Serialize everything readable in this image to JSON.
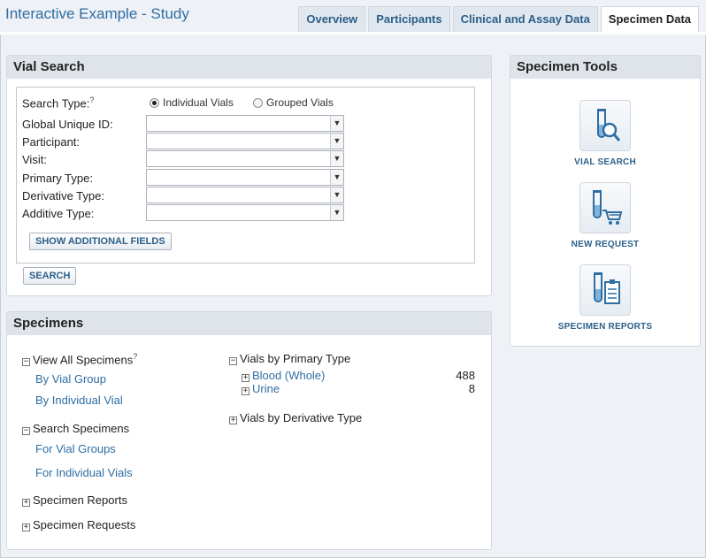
{
  "header": {
    "title": "Interactive Example - Study",
    "tabs": [
      {
        "label": "Overview",
        "active": false
      },
      {
        "label": "Participants",
        "active": false
      },
      {
        "label": "Clinical and Assay Data",
        "active": false
      },
      {
        "label": "Specimen Data",
        "active": true
      }
    ]
  },
  "vial_search": {
    "title": "Vial Search",
    "search_type_label": "Search Type:",
    "help_mark": "?",
    "options": [
      {
        "label": "Individual Vials",
        "selected": true
      },
      {
        "label": "Grouped Vials",
        "selected": false
      }
    ],
    "fields": [
      {
        "label": "Global Unique ID:",
        "value": ""
      },
      {
        "label": "Participant:",
        "value": ""
      },
      {
        "label": "Visit:",
        "value": ""
      },
      {
        "label": "Primary Type:",
        "value": ""
      },
      {
        "label": "Derivative Type:",
        "value": ""
      },
      {
        "label": "Additive Type:",
        "value": ""
      }
    ],
    "show_fields_button": "SHOW ADDITIONAL FIELDS",
    "search_button": "SEARCH"
  },
  "specimens": {
    "title": "Specimens",
    "view_all": "View All Specimens",
    "help_mark": "?",
    "by_vial_group": "By Vial Group",
    "by_individual_vial": "By Individual Vial",
    "search_specimens": "Search Specimens",
    "for_vial_groups": "For Vial Groups",
    "for_individual_vials": "For Individual Vials",
    "specimen_reports": "Specimen Reports",
    "specimen_requests": "Specimen Requests",
    "vials_by_primary_type": "Vials by Primary Type",
    "primary_types": [
      {
        "label": "Blood (Whole)",
        "count": "488"
      },
      {
        "label": "Urine",
        "count": "8"
      }
    ],
    "vials_by_derivative_type": "Vials by Derivative Type"
  },
  "specimen_tools": {
    "title": "Specimen Tools",
    "tools": [
      {
        "label": "VIAL SEARCH",
        "icon": "test-tube-magnifier-icon"
      },
      {
        "label": "NEW REQUEST",
        "icon": "test-tube-cart-icon"
      },
      {
        "label": "SPECIMEN REPORTS",
        "icon": "test-tube-clipboard-icon"
      }
    ]
  },
  "colors": {
    "accent": "#2f6da3",
    "panel_header": "#dfe4ea",
    "background": "#eef1f5"
  }
}
